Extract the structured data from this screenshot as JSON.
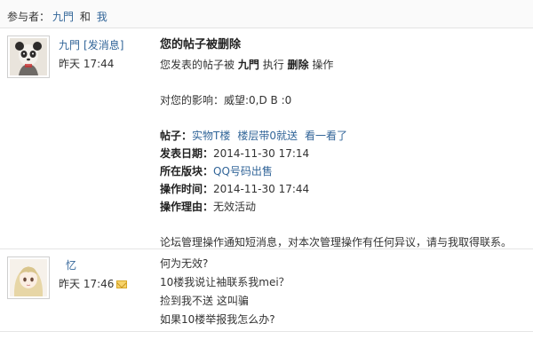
{
  "participants": {
    "label": "参与者：",
    "user1": "九門",
    "conjunction": "和",
    "user2": "我"
  },
  "message1": {
    "author": "九門",
    "action": "[发消息]",
    "time": "昨天 17:44",
    "subject": "您的帖子被删除",
    "op_prefix": "您发表的帖子被",
    "op_user": "九門",
    "op_mid": "执行",
    "op_action": "删除",
    "op_suffix": "操作",
    "impact": "对您的影响：威望:0,D B :0",
    "post_label": "帖子：",
    "post_title": "实物T楼",
    "post_link2": "楼层带0就送",
    "post_link3": "看一看了",
    "date_label": "发表日期：",
    "date_value": "2014-11-30 17:14",
    "board_label": "所在版块：",
    "board_value": "QQ号码出售",
    "optime_label": "操作时间：",
    "optime_value": "2014-11-30 17:44",
    "reason_label": "操作理由：",
    "reason_value": "无效活动",
    "footer": "论坛管理操作通知短消息，对本次管理操作有任何异议，请与我取得联系。"
  },
  "message2": {
    "author": "忆",
    "time": "昨天  17:46",
    "lines": [
      "何为无效?",
      "10楼我说让袖联系我mei？",
      "捡到我不送 这叫骗",
      "如果10楼举报我怎么办?"
    ]
  },
  "colors": {
    "link": "#336699",
    "separator": "#e5e5e5"
  }
}
